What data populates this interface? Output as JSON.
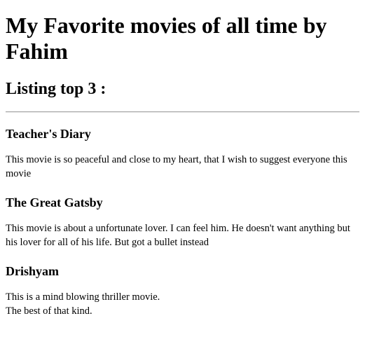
{
  "heading": "My Favorite movies of all time by Fahim",
  "subheading": "Listing top 3 :",
  "movies": [
    {
      "title": "Teacher's Diary",
      "description": "This movie is so peaceful and close to my heart, that I wish to suggest everyone this movie"
    },
    {
      "title": "The Great Gatsby",
      "description": "This movie is about a unfortunate lover. I can feel him. He doesn't want anything but his lover for all of his life. But got a bullet instead"
    },
    {
      "title": "Drishyam",
      "description_lines": [
        "This is a mind blowing thriller movie.",
        "The best of that kind."
      ]
    }
  ]
}
